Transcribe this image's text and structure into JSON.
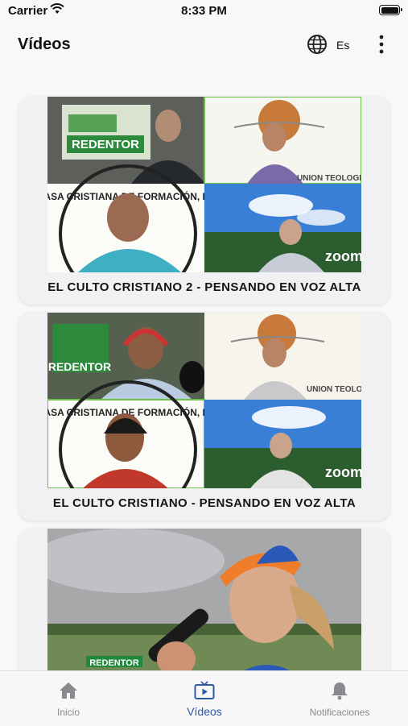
{
  "status": {
    "carrier": "Carrier",
    "time": "8:33 PM"
  },
  "header": {
    "title": "Vídeos",
    "language": "Es",
    "globe_icon": "globe-icon",
    "more_icon": "more-vertical-icon"
  },
  "videos": [
    {
      "title": "EL CULTO CRISTIANO 2 - PENSANDO EN VOZ ALTA",
      "overlay": {
        "station": "REDENTOR",
        "org": "CASA CRISTIANA DE FORMACIÓN, INC",
        "seminary": "UNION TEOLOGICA",
        "zoom": "zoom"
      }
    },
    {
      "title": "EL CULTO CRISTIANO - PENSANDO EN VOZ ALTA",
      "overlay": {
        "station": "REDENTOR",
        "org": "CASA CRISTIANA DE FORMACIÓN, INC",
        "seminary": "UNION TEOLOGICA",
        "zoom": "zoom"
      }
    },
    {
      "title": "",
      "overlay": {
        "station": "REDENTOR"
      }
    }
  ],
  "tabs": [
    {
      "label": "Inicio",
      "icon": "home-icon",
      "active": false
    },
    {
      "label": "Vídeos",
      "icon": "tv-play-icon",
      "active": true
    },
    {
      "label": "Notificaciones",
      "icon": "bell-icon",
      "active": false
    }
  ],
  "colors": {
    "accent": "#2f5aa8",
    "inactive": "#8a8a8e"
  }
}
